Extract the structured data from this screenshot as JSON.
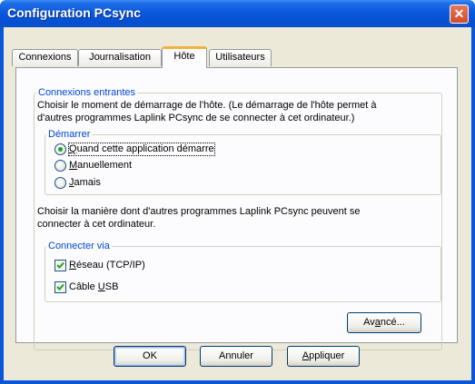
{
  "window": {
    "title": "Configuration PCsync",
    "close_glyph": "✕"
  },
  "tabs": [
    {
      "label": "Connexions"
    },
    {
      "label": "Journalisation"
    },
    {
      "label": "Hôte"
    },
    {
      "label": "Utilisateurs"
    }
  ],
  "active_tab": "Hôte",
  "incoming": {
    "legend": "Connexions entrantes",
    "description": [
      "Choisir le moment de démarrage de l'hôte. (Le démarrage de l'hôte permet à",
      "d'autres programmes Laplink PCsync de se connecter à cet ordinateur.)"
    ],
    "start_group": {
      "legend": "Démarrer",
      "options": [
        {
          "label": "Quand cette application démarre",
          "mnemonic_index": 0,
          "selected": true
        },
        {
          "label": "Manuellement",
          "mnemonic_index": 0,
          "selected": false
        },
        {
          "label": "Jamais",
          "mnemonic_index": 0,
          "selected": false
        }
      ]
    },
    "connect_description": [
      "Choisir la manière dont d'autres programmes Laplink PCsync peuvent se",
      "connecter à cet ordinateur."
    ],
    "connect_group": {
      "legend": "Connecter via",
      "options": [
        {
          "label": "Réseau (TCP/IP)",
          "mnemonic_index": 0,
          "checked": true
        },
        {
          "label": "Câble USB",
          "mnemonic_index": 6,
          "checked": true
        }
      ]
    },
    "advanced_button": {
      "label": "Avancé...",
      "mnemonic_index": 2
    }
  },
  "buttons": [
    {
      "label": "OK",
      "mnemonic_index": -1
    },
    {
      "label": "Annuler",
      "mnemonic_index": -1
    },
    {
      "label": "Appliquer",
      "mnemonic_index": 0
    }
  ],
  "colors": {
    "titlebar": "#0a58dc",
    "client": "#ece9d8",
    "legend_text": "#0046d5",
    "tab_highlight": "#f2b33d",
    "radio_dot": "#21a121",
    "check_mark": "#21a121",
    "close_button": "#d24a2a"
  }
}
